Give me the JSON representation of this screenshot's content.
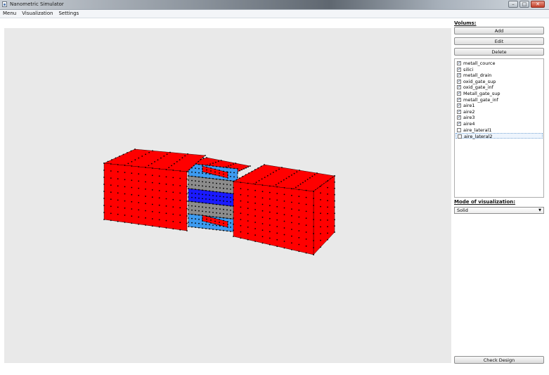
{
  "window": {
    "title": "Nanometric Simulator",
    "minimize_glyph": "–",
    "maximize_glyph": "□",
    "close_glyph": "✕"
  },
  "menubar": {
    "items": [
      "Menu",
      "Visualization",
      "Settings"
    ]
  },
  "side_panel": {
    "volumes_label": "Volums:",
    "add_label": "Add",
    "edit_label": "Edit",
    "delete_label": "Delete",
    "volumes": [
      {
        "name": "metall_cource",
        "checked": true
      },
      {
        "name": "silici",
        "checked": true
      },
      {
        "name": "metall_drain",
        "checked": true
      },
      {
        "name": "oxid_gate_sup",
        "checked": true
      },
      {
        "name": "oxid_gate_inf",
        "checked": true
      },
      {
        "name": "Metall_gate_sup",
        "checked": true
      },
      {
        "name": "metall_gate_inf",
        "checked": true
      },
      {
        "name": "aire1",
        "checked": true
      },
      {
        "name": "aire2",
        "checked": true
      },
      {
        "name": "aire3",
        "checked": true
      },
      {
        "name": "aire4",
        "checked": true
      },
      {
        "name": "aire_lateral1",
        "checked": false
      },
      {
        "name": "aire_lateral2",
        "checked": false,
        "selected": true
      }
    ],
    "mode_label": "Mode of visualization:",
    "mode_value": "Solid",
    "check_design_label": "Check Design"
  },
  "colors": {
    "metal": "#ff0000",
    "oxide": "#3d9bf0",
    "silicon": "#1a1aff",
    "gray": "#8c8c8c",
    "viewport_bg": "#e9e9e9"
  }
}
